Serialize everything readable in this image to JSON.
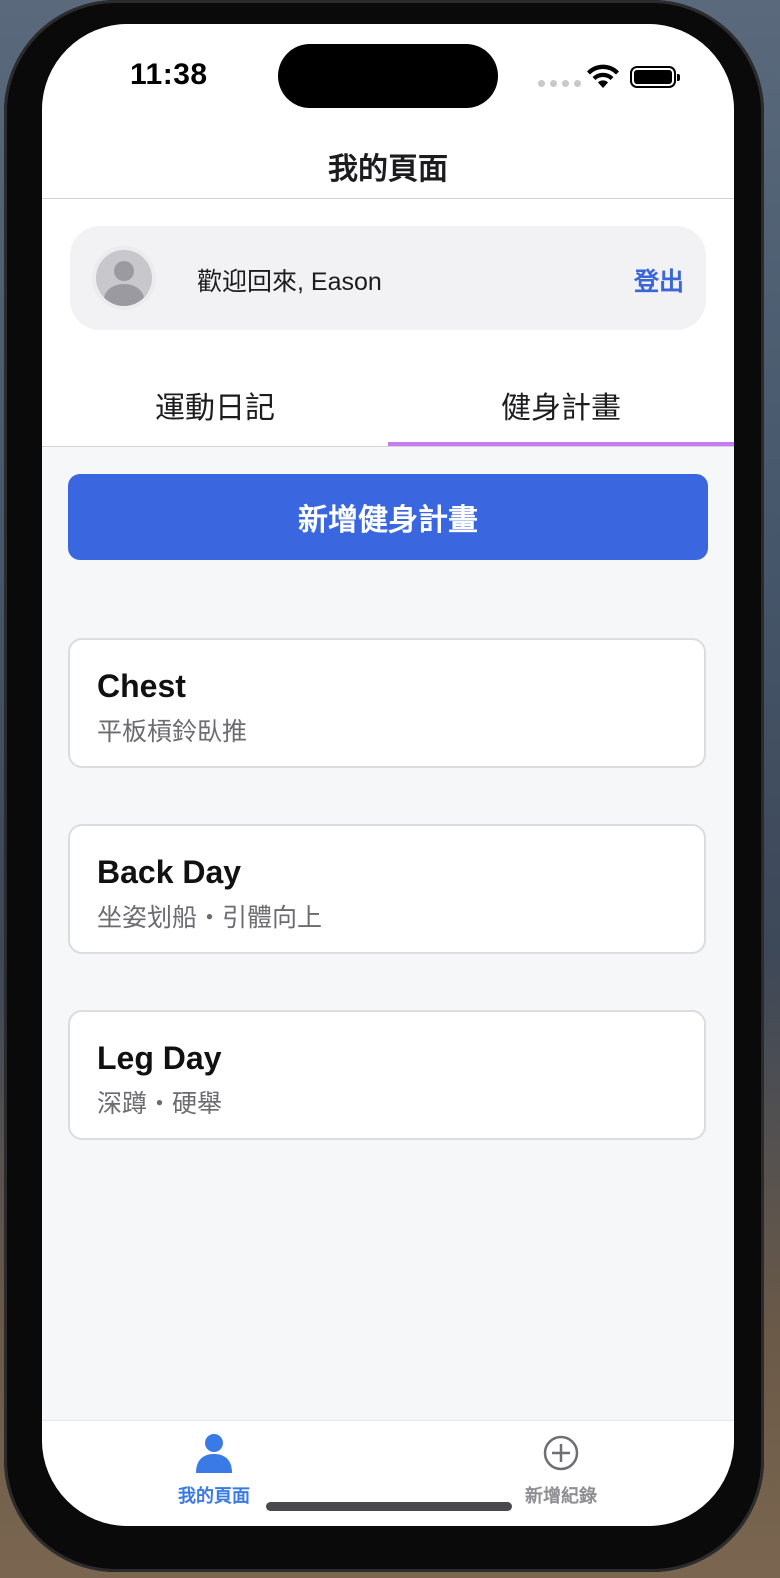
{
  "status_bar": {
    "time": "11:38"
  },
  "nav": {
    "title": "我的頁面"
  },
  "profile": {
    "welcome_text": "歡迎回來, Eason",
    "logout_label": "登出"
  },
  "tabs": [
    {
      "label": "運動日記",
      "active": false
    },
    {
      "label": "健身計畫",
      "active": true
    }
  ],
  "add_plan_button": {
    "label": "新增健身計畫"
  },
  "plans": [
    {
      "name": "Chest",
      "exercises": "平板槓鈴臥推"
    },
    {
      "name": "Back Day",
      "exercises": "坐姿划船・引體向上"
    },
    {
      "name": "Leg Day",
      "exercises": "深蹲・硬舉"
    }
  ],
  "tab_bar": {
    "items": [
      {
        "label": "我的頁面",
        "icon": "person-icon",
        "active": true
      },
      {
        "label": "新增紀錄",
        "icon": "plus-circle-icon",
        "active": false
      }
    ]
  },
  "colors": {
    "accent": "#3a66e0",
    "tab_indicator": "#c57cf0",
    "active_tab_icon": "#3a7ae6",
    "link": "#3a66d6"
  }
}
